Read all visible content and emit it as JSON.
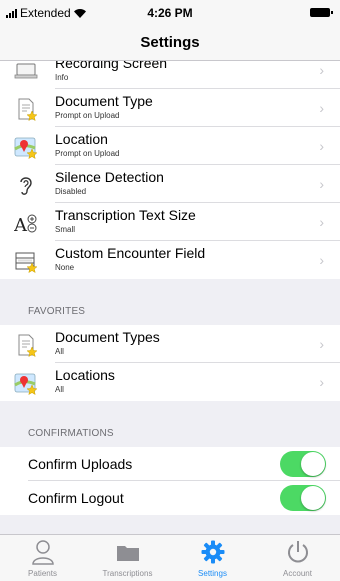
{
  "status_bar": {
    "carrier": "Extended",
    "time": "4:26 PM"
  },
  "nav": {
    "title": "Settings"
  },
  "settings": [
    {
      "title": "Recording Screen",
      "subtitle": "Info",
      "icon": "device-icon"
    },
    {
      "title": "Document Type",
      "subtitle": "Prompt on Upload",
      "icon": "document-star-icon"
    },
    {
      "title": "Location",
      "subtitle": "Prompt on Upload",
      "icon": "map-pin-icon"
    },
    {
      "title": "Silence Detection",
      "subtitle": "Disabled",
      "icon": "ear-icon"
    },
    {
      "title": "Transcription Text Size",
      "subtitle": "Small",
      "icon": "text-size-icon"
    },
    {
      "title": "Custom Encounter Field",
      "subtitle": "None",
      "icon": "form-field-icon"
    }
  ],
  "favorites": {
    "header": "FAVORITES",
    "items": [
      {
        "title": "Document Types",
        "subtitle": "All",
        "icon": "document-star-icon"
      },
      {
        "title": "Locations",
        "subtitle": "All",
        "icon": "map-pin-icon"
      }
    ]
  },
  "confirmations": {
    "header": "CONFIRMATIONS",
    "items": [
      {
        "title": "Confirm Uploads",
        "on": true
      },
      {
        "title": "Confirm Logout",
        "on": true
      }
    ]
  },
  "tabs": [
    {
      "label": "Patients",
      "icon": "person-icon",
      "active": false
    },
    {
      "label": "Transcriptions",
      "icon": "folder-icon",
      "active": false
    },
    {
      "label": "Settings",
      "icon": "gear-icon",
      "active": true
    },
    {
      "label": "Account",
      "icon": "power-icon",
      "active": false
    }
  ],
  "colors": {
    "accent": "#1a8cf7",
    "toggle_on": "#4cd964",
    "background": "#efeff4"
  }
}
